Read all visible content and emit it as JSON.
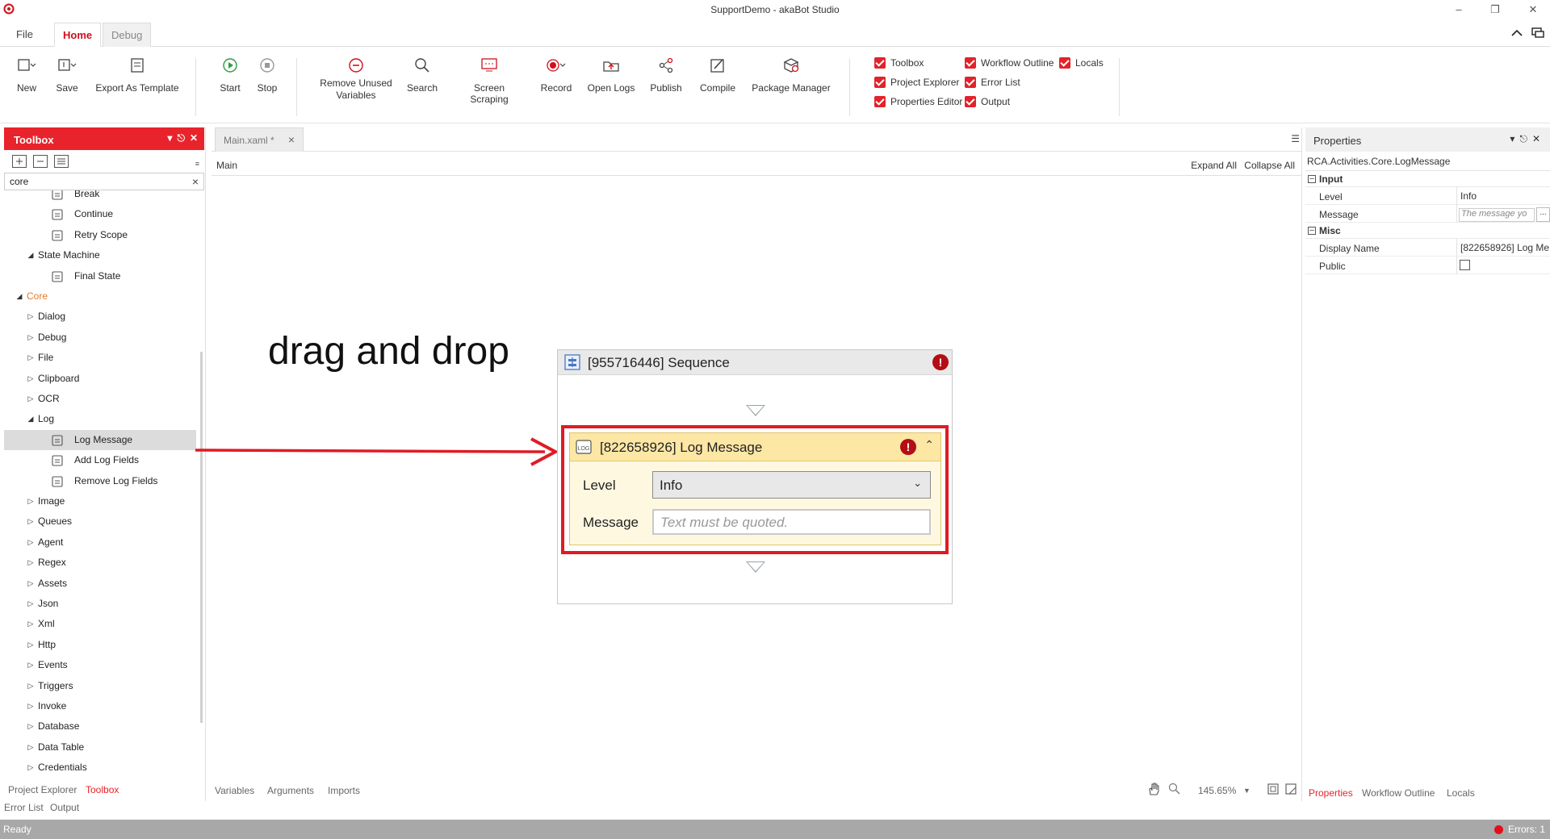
{
  "window": {
    "title": "SupportDemo - akaBot Studio"
  },
  "ribbon_tabs": [
    {
      "label": "File"
    },
    {
      "label": "Home"
    },
    {
      "label": "Debug"
    }
  ],
  "ribbon": {
    "new": "New",
    "save": "Save",
    "export_template": "Export As Template",
    "start": "Start",
    "stop": "Stop",
    "remove_unused_line1": "Remove Unused",
    "remove_unused_line2": "Variables",
    "search": "Search",
    "screen_scraping": "Screen Scraping",
    "record": "Record",
    "open_logs": "Open Logs",
    "publish": "Publish",
    "compile": "Compile",
    "package_manager": "Package Manager",
    "panels": {
      "toolbox": "Toolbox",
      "project_explorer": "Project Explorer",
      "properties_editor": "Properties Editor",
      "workflow_outline": "Workflow Outline",
      "error_list": "Error List",
      "output": "Output",
      "locals": "Locals"
    },
    "accent_color": "#e1232b"
  },
  "toolbox": {
    "title": "Toolbox",
    "search_value": "core",
    "tree": [
      {
        "label": "Break",
        "level": 2,
        "kind": "leaf"
      },
      {
        "label": "Continue",
        "level": 2,
        "kind": "leaf"
      },
      {
        "label": "Retry Scope",
        "level": 2,
        "kind": "leaf"
      },
      {
        "label": "State Machine",
        "level": 1,
        "kind": "expanded"
      },
      {
        "label": "Final State",
        "level": 2,
        "kind": "leaf"
      },
      {
        "label": "Core",
        "level": 0,
        "kind": "expanded"
      },
      {
        "label": "Dialog",
        "level": 1,
        "kind": "collapsed"
      },
      {
        "label": "Debug",
        "level": 1,
        "kind": "collapsed"
      },
      {
        "label": "File",
        "level": 1,
        "kind": "collapsed"
      },
      {
        "label": "Clipboard",
        "level": 1,
        "kind": "collapsed"
      },
      {
        "label": "OCR",
        "level": 1,
        "kind": "collapsed"
      },
      {
        "label": "Log",
        "level": 1,
        "kind": "expanded"
      },
      {
        "label": "Log Message",
        "level": 2,
        "kind": "leaf",
        "selected": true
      },
      {
        "label": "Add Log Fields",
        "level": 2,
        "kind": "leaf"
      },
      {
        "label": "Remove Log Fields",
        "level": 2,
        "kind": "leaf"
      },
      {
        "label": "Image",
        "level": 1,
        "kind": "collapsed"
      },
      {
        "label": "Queues",
        "level": 1,
        "kind": "collapsed"
      },
      {
        "label": "Agent",
        "level": 1,
        "kind": "collapsed"
      },
      {
        "label": "Regex",
        "level": 1,
        "kind": "collapsed"
      },
      {
        "label": "Assets",
        "level": 1,
        "kind": "collapsed"
      },
      {
        "label": "Json",
        "level": 1,
        "kind": "collapsed"
      },
      {
        "label": "Xml",
        "level": 1,
        "kind": "collapsed"
      },
      {
        "label": "Http",
        "level": 1,
        "kind": "collapsed"
      },
      {
        "label": "Events",
        "level": 1,
        "kind": "collapsed"
      },
      {
        "label": "Triggers",
        "level": 1,
        "kind": "collapsed"
      },
      {
        "label": "Invoke",
        "level": 1,
        "kind": "collapsed"
      },
      {
        "label": "Database",
        "level": 1,
        "kind": "collapsed"
      },
      {
        "label": "Data Table",
        "level": 1,
        "kind": "collapsed"
      },
      {
        "label": "Credentials",
        "level": 1,
        "kind": "collapsed"
      }
    ]
  },
  "left_bottom_tabs": {
    "project_explorer": "Project Explorer",
    "toolbox": "Toolbox",
    "error_list": "Error List",
    "output": "Output"
  },
  "document": {
    "tab": "Main.xaml *",
    "breadcrumb": "Main",
    "expand_all": "Expand All",
    "collapse_all": "Collapse All",
    "annotation": "drag and drop",
    "sequence_title": "[955716446] Sequence",
    "log_title": "[822658926] Log Message",
    "level_label": "Level",
    "level_value": "Info",
    "message_label": "Message",
    "message_placeholder": "Text must be quoted.",
    "bottom_tabs": {
      "variables": "Variables",
      "arguments": "Arguments",
      "imports": "Imports"
    },
    "zoom": "145.65%"
  },
  "properties": {
    "title": "Properties",
    "type": "RCA.Activities.Core.LogMessage",
    "input_category": "Input",
    "level_name": "Level",
    "level_value": "Info",
    "message_name": "Message",
    "message_placeholder": "The message yo",
    "misc_category": "Misc",
    "display_name_name": "Display Name",
    "display_name_value": "[822658926] Log Me",
    "public_name": "Public",
    "bottom_tabs": {
      "properties": "Properties",
      "workflow_outline": "Workflow Outline",
      "locals": "Locals"
    }
  },
  "status": {
    "text": "Ready",
    "errors": "Errors: 1"
  }
}
